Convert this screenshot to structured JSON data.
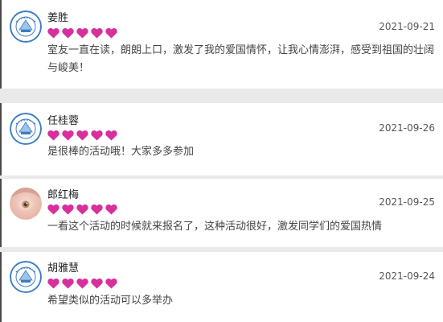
{
  "rating_color": "#d6309c",
  "comments": [
    {
      "avatar": "university-seal-icon",
      "name": "姜胜",
      "rating": 5,
      "date": "2021-09-21",
      "text": "室友一直在读，朗朗上口，激发了我的爱国情怀，让我心情澎湃，感受到祖国的壮阔与峻美！"
    },
    {
      "avatar": "university-seal-icon",
      "name": "任桂蓉",
      "rating": 5,
      "date": "2021-09-26",
      "text": "是很棒的活动哦！大家多多参加"
    },
    {
      "avatar": "user-photo-avatar",
      "name": "郎红梅",
      "rating": 5,
      "date": "2021-09-25",
      "text": "一看这个活动的时候就来报名了，这种活动很好，激发同学们的爱国热情"
    },
    {
      "avatar": "university-seal-icon",
      "name": "胡雅慧",
      "rating": 5,
      "date": "2021-09-24",
      "text": "希望类似的活动可以多举办"
    }
  ]
}
